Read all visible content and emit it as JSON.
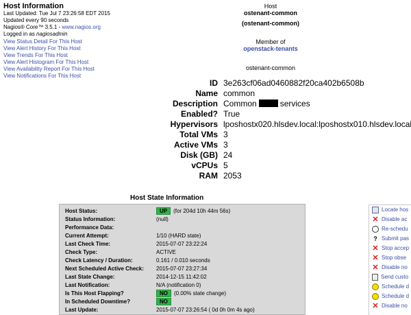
{
  "host_info": {
    "title": "Host Information",
    "last_updated": "Last Updated: Tue Jul 7 23:26:58 EDT 2015",
    "update_interval": "Updated every 90 seconds",
    "version_prefix": "Nagios® Core™ 3.5.1 - ",
    "version_link": "www.nagios.org",
    "logged_in_prefix": "Logged in as ",
    "logged_in_user": "nagiosadmin"
  },
  "links": [
    "View Status Detail For This Host",
    "View Alert History For This Host",
    "View Trends For This Host",
    "View Alert Histogram For This Host",
    "View Availability Report For This Host",
    "View Notifications For This Host"
  ],
  "host_header": {
    "label": "Host",
    "name": "ostenant-common",
    "alias": "(ostenant-common)",
    "member_of_label": "Member of",
    "group_link": "openstack-tenants",
    "address": "ostenant-common"
  },
  "details": [
    {
      "label": "ID",
      "value": "3e263cf06ad0460882f20ca402b6508b"
    },
    {
      "label": "Name",
      "value": "common"
    },
    {
      "label": "Description",
      "value_pre": "Common",
      "value_post": "services"
    },
    {
      "label": "Enabled?",
      "value": "True"
    },
    {
      "label": "Hypervisors",
      "value": "lposhostx020.hlsdev.local:lposhostx010.hlsdev.local:"
    },
    {
      "label": "Total VMs",
      "value": "3"
    },
    {
      "label": "Active VMs",
      "value": "3"
    },
    {
      "label": "Disk (GB)",
      "value": "24"
    },
    {
      "label": "vCPUs",
      "value": "5"
    },
    {
      "label": "RAM",
      "value": "2053"
    }
  ],
  "state": {
    "title": "Host State Information",
    "rows": [
      {
        "label": "Host Status:",
        "badge": "UP",
        "value": "(for 204d 10h 44m 56s)"
      },
      {
        "label": "Status Information:",
        "value": "(null)"
      },
      {
        "label": "Performance Data:",
        "value": ""
      },
      {
        "label": "Current Attempt:",
        "value": "1/10  (HARD state)"
      },
      {
        "label": "Last Check Time:",
        "value": "2015-07-07 23:22:24"
      },
      {
        "label": "Check Type:",
        "value": "ACTIVE"
      },
      {
        "label": "Check Latency / Duration:",
        "value": "0.161 / 0.010 seconds"
      },
      {
        "label": "Next Scheduled Active Check:",
        "value": "2015-07-07 23:27:34"
      },
      {
        "label": "Last State Change:",
        "value": "2014-12-15 11:42:02"
      },
      {
        "label": "Last Notification:",
        "value": "N/A (notification 0)"
      },
      {
        "label": "Is This Host Flapping?",
        "badge": "NO",
        "value": "(0.00% state change)"
      },
      {
        "label": "In Scheduled Downtime?",
        "badge": "NO",
        "value": ""
      },
      {
        "label": "Last Update:",
        "value": "2015-07-07 23:26:54  ( 0d 0h 0m 4s ago)"
      }
    ]
  },
  "commands": [
    {
      "icon": "box",
      "label": "Locate hos"
    },
    {
      "icon": "x",
      "label": "Disable ac"
    },
    {
      "icon": "clock",
      "label": "Re-schedu"
    },
    {
      "icon": "q",
      "label": "Submit pas"
    },
    {
      "icon": "x",
      "label": "Stop accep"
    },
    {
      "icon": "x",
      "label": "Stop obse"
    },
    {
      "icon": "x",
      "label": "Disable no"
    },
    {
      "icon": "doc",
      "label": "Send custo"
    },
    {
      "icon": "yclock",
      "label": "Schedule d"
    },
    {
      "icon": "yclock",
      "label": "Schedule d"
    },
    {
      "icon": "x",
      "label": "Disable no"
    }
  ]
}
